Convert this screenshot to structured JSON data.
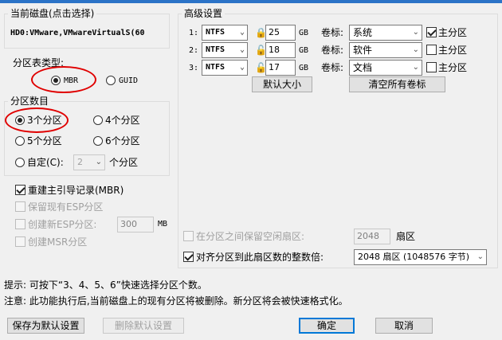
{
  "disk": {
    "group_title": "当前磁盘(点击选择)",
    "name": "HD0:VMware,VMwareVirtualS(60"
  },
  "partition_type": {
    "label": "分区表类型:",
    "options": [
      "MBR",
      "GUID"
    ],
    "selected": "MBR"
  },
  "partition_count": {
    "group_title": "分区数目",
    "options": [
      "3个分区",
      "4个分区",
      "5个分区",
      "6个分区"
    ],
    "selected": "3个分区",
    "custom_label": "自定(C):",
    "custom_value": "2",
    "custom_suffix": "个分区"
  },
  "options": {
    "rebuild_mbr": "重建主引导记录(MBR)",
    "keep_esp": "保留现有ESP分区",
    "create_esp": "创建新ESP分区:",
    "esp_size": "300",
    "esp_unit": "MB",
    "create_msr": "创建MSR分区"
  },
  "advanced": {
    "group_title": "高级设置",
    "volume_label_text": "卷标:",
    "primary_text": "主分区",
    "rows": [
      {
        "index": "1:",
        "fs": "NTFS",
        "size": "25",
        "unit": "GB",
        "label": "系统",
        "primary": true
      },
      {
        "index": "2:",
        "fs": "NTFS",
        "size": "18",
        "unit": "GB",
        "label": "软件",
        "primary": false
      },
      {
        "index": "3:",
        "fs": "NTFS",
        "size": "17",
        "unit": "GB",
        "label": "文档",
        "primary": false
      }
    ],
    "default_size_button": "默认大小",
    "clear_labels_button": "清空所有卷标"
  },
  "reserve": {
    "label": "在分区之间保留空闲扇区:",
    "value": "2048",
    "unit": "扇区"
  },
  "align": {
    "label": "对齐分区到此扇区数的整数倍:",
    "value": "2048 扇区 (1048576 字节)"
  },
  "hints": {
    "line1": "提示: 可按下“3、4、5、6”快速选择分区个数。",
    "line2": "注意: 此功能执行后,当前磁盘上的现有分区将被删除。新分区将会被快速格式化。"
  },
  "buttons": {
    "save_default": "保存为默认设置",
    "delete_default": "删除默认设置",
    "ok": "确定",
    "cancel": "取消"
  },
  "colors": {
    "highlight": "#e00000",
    "accent": "#0078d7"
  }
}
